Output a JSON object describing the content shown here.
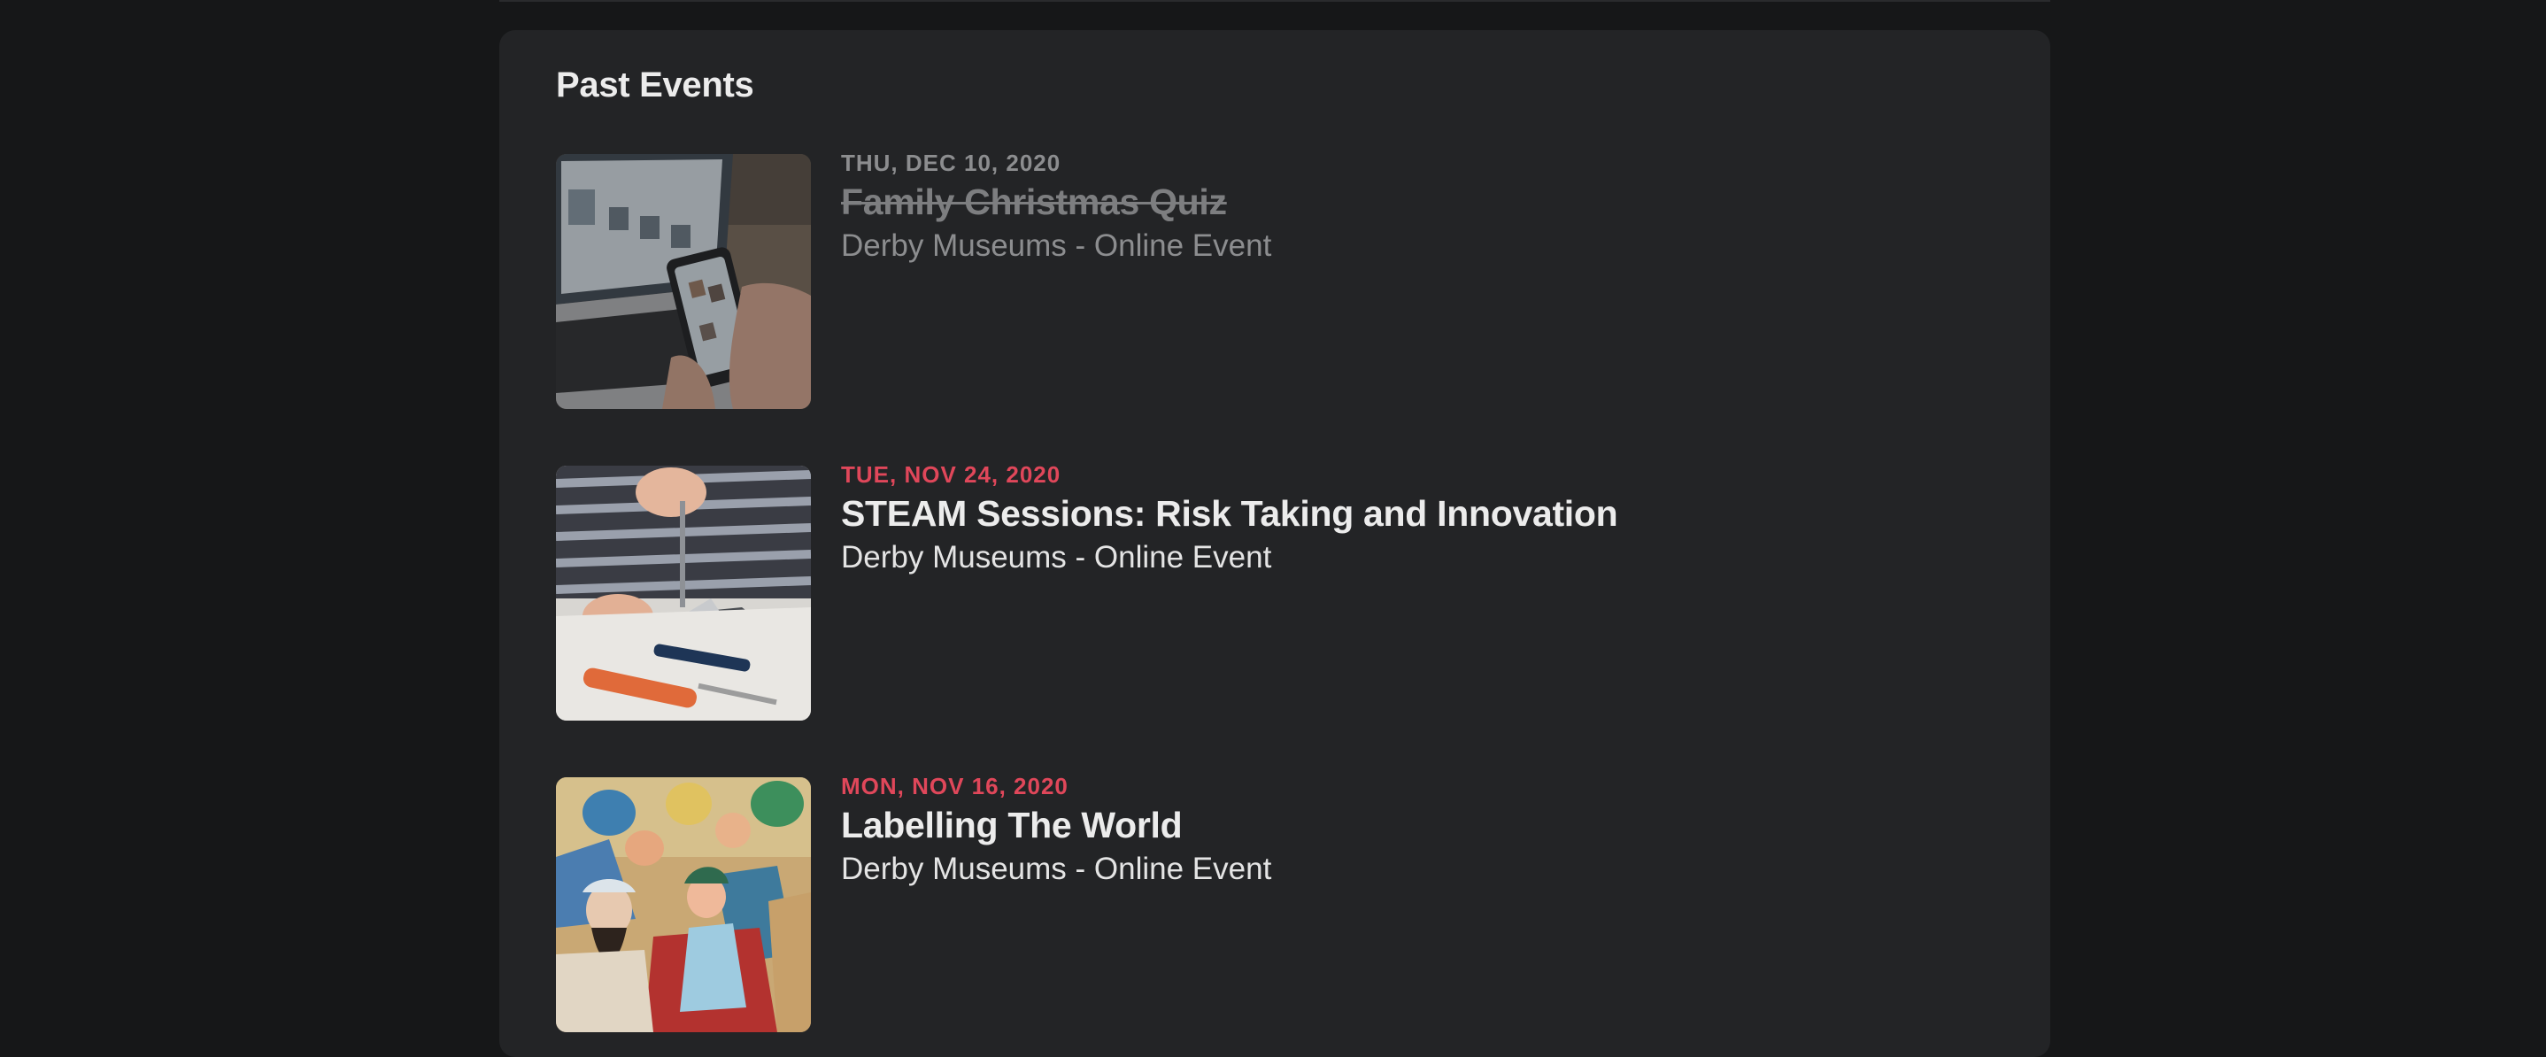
{
  "section": {
    "title": "Past Events"
  },
  "events": [
    {
      "date": "THU, DEC 10, 2020",
      "title": "Family Christmas Quiz",
      "venue": "Derby Museums - Online Event",
      "status": "cancelled",
      "image": "laptop-and-phone-photo"
    },
    {
      "date": "TUE, NOV 24, 2020",
      "title": "STEAM Sessions: Risk Taking and Innovation",
      "venue": "Derby Museums - Online Event",
      "status": "past",
      "image": "robotic-hand-and-screwdrivers-photo"
    },
    {
      "date": "MON, NOV 16, 2020",
      "title": "Labelling The World",
      "venue": "Derby Museums - Online Event",
      "status": "past",
      "image": "painting-of-crowd-photo"
    }
  ],
  "colors": {
    "background": "#161718",
    "card": "#232426",
    "accent_date": "#e0475a",
    "muted": "#8c8d8f",
    "text": "#ececec"
  }
}
